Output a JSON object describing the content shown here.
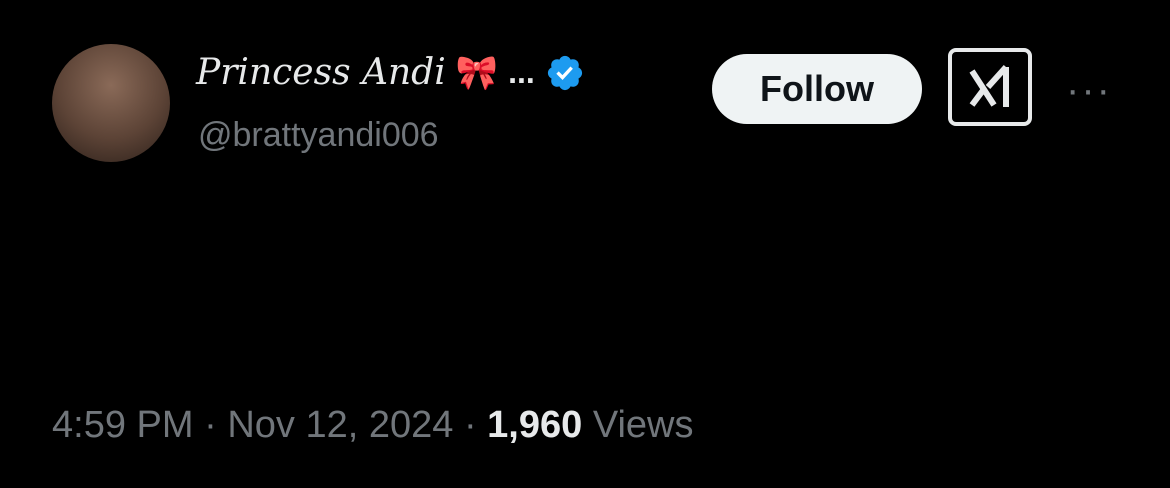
{
  "author": {
    "display_name": "Princess Andi",
    "name_emoji": "🎀",
    "name_truncation": "...",
    "handle": "@brattyandi006",
    "verified": true
  },
  "actions": {
    "follow_label": "Follow",
    "grok_icon": "grok-icon",
    "more_label": "···"
  },
  "tweet": {
    "text": ""
  },
  "meta": {
    "time": "4:59 PM",
    "separator": "·",
    "date": "Nov 12, 2024",
    "views_count": "1,960",
    "views_label": "Views"
  },
  "colors": {
    "background": "#000000",
    "text": "#e7e9ea",
    "secondary": "#71767b",
    "verified": "#1d9bf0",
    "follow_bg": "#eff3f4"
  }
}
